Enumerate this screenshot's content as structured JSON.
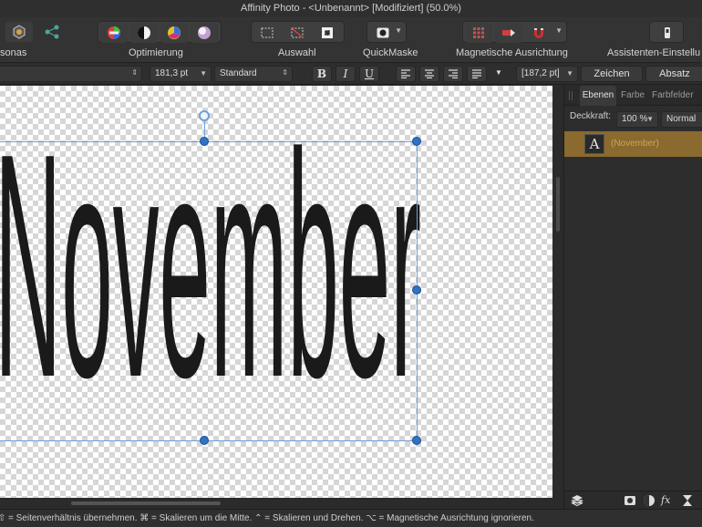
{
  "window": {
    "title": "Affinity Photo - <Unbenannt> [Modifiziert] (50.0%)"
  },
  "toolbar": {
    "labels": {
      "personas": "sonas",
      "optimierung": "Optimierung",
      "auswahl": "Auswahl",
      "quickmaske": "QuickMaske",
      "magnetische": "Magnetische Ausrichtung",
      "assistenten": "Assistenten-Einstellu"
    },
    "icons": [
      "photo-persona-icon",
      "share-icon",
      "color-wheel-icon",
      "contrast-icon",
      "color-balance-icon",
      "gradient-sphere-icon",
      "marquee-icon",
      "deselect-icon",
      "invert-selection-icon",
      "quickmask-icon",
      "snapping-grid-icon",
      "snapping-move-icon",
      "magnet-icon",
      "assistant-icon"
    ]
  },
  "context": {
    "font_size": "181,3 pt",
    "style": "Standard",
    "bold": "B",
    "italic": "I",
    "underline": "U",
    "leading": "[187,2 pt]",
    "zeichen": "Zeichen",
    "absatz": "Absatz"
  },
  "canvas": {
    "text": "November",
    "text_color": "#1a1a1a",
    "selection_color": "#6ea0d8",
    "handle_color": "#2f72c6"
  },
  "panel": {
    "tabs": [
      "Ebenen",
      "Farbe",
      "Farbfelder"
    ],
    "opacity_label": "Deckkraft:",
    "opacity_value": "100 %",
    "blend_mode": "Normal",
    "layer": {
      "thumb_letter": "A",
      "name": "(November)",
      "highlight": "#8a6a2e"
    },
    "bottom_icons": [
      "layers-icon",
      "mask-icon",
      "adjustment-icon",
      "fx-icon",
      "hourglass-icon"
    ]
  },
  "status": {
    "text": "Textrahmengröße ändern. ⇧ = Seitenverhältnis übernehmen. ⌘ = Skalieren um die Mitte. ⌃ = Skalieren und Drehen. ⌥ = Magnetische Ausrichtung ignorieren."
  }
}
